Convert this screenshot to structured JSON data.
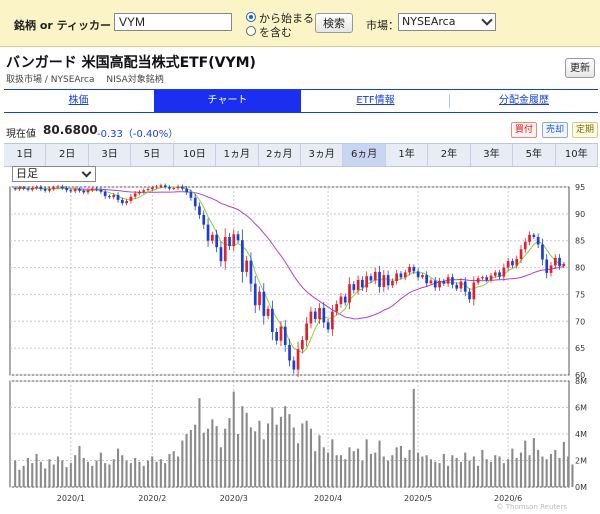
{
  "search": {
    "label": "銘柄 or ティッカー",
    "ticker_value": "VYM",
    "radio_starts": "から始まる",
    "radio_contains": "を含む",
    "search_button": "検索",
    "market_label": "市場：",
    "market_value": "NYSEArca"
  },
  "header": {
    "title": "バンガード 米国高配当株式ETF(VYM)",
    "subtitle": "取扱市場 / NYSEArca　 NISA対象銘柄",
    "refresh_button": "更新"
  },
  "tabs": [
    {
      "label": "株価",
      "active": false
    },
    {
      "label": "チャート",
      "active": true
    },
    {
      "label": "ETF情報",
      "active": false
    },
    {
      "label": "分配金履歴",
      "active": false
    }
  ],
  "price": {
    "label": "現在値",
    "value": "80.6800",
    "change": "-0.33（-0.40%）",
    "buy_label": "買付",
    "sell_label": "売却",
    "fixed_label": "定期"
  },
  "periods": [
    "1日",
    "2日",
    "3日",
    "5日",
    "10日",
    "1ヵ月",
    "2ヵ月",
    "3ヵ月",
    "6ヵ月",
    "1年",
    "2年",
    "3年",
    "5年",
    "10年"
  ],
  "active_period": "6ヵ月",
  "interval": "日足",
  "colors": {
    "up": "#e0202a",
    "down": "#1a3fd8",
    "ma_short": "#8ccf3a",
    "ma_long": "#b23fd3",
    "volume": "#8a8a8a",
    "accent": "#1a2ff0"
  },
  "chart_data": {
    "type": "candlestick",
    "price_axis": {
      "ticks": [
        "95",
        "90",
        "85",
        "80",
        "75",
        "70",
        "65",
        "60"
      ],
      "ylim": [
        60,
        95
      ]
    },
    "volume_axis": {
      "ticks": [
        "8M",
        "6M",
        "4M",
        "2M",
        "0M"
      ],
      "ylim": [
        0,
        8
      ]
    },
    "x_tick_labels": [
      "2020/1",
      "2020/2",
      "2020/3",
      "2020/4",
      "2020/5",
      "2020/6"
    ],
    "x_tick_index": [
      13,
      32,
      51,
      73,
      94,
      115
    ],
    "closes": [
      94.6,
      94.9,
      94.7,
      94.5,
      94.8,
      95.0,
      94.6,
      94.3,
      94.6,
      94.9,
      95.1,
      94.8,
      94.4,
      94.2,
      94.6,
      94.3,
      94.0,
      94.4,
      94.7,
      94.5,
      94.1,
      93.3,
      93.1,
      93.5,
      92.6,
      92.0,
      92.4,
      93.2,
      93.8,
      94.1,
      94.4,
      94.6,
      94.9,
      95.1,
      95.3,
      95.0,
      94.7,
      94.8,
      95.1,
      94.7,
      94.0,
      93.0,
      91.4,
      89.8,
      88.0,
      85.0,
      86.1,
      83.8,
      81.2,
      85.7,
      84.0,
      86.2,
      85.1,
      79.2,
      81.3,
      77.0,
      73.0,
      75.5,
      71.0,
      72.3,
      68.0,
      66.4,
      69.0,
      65.6,
      62.7,
      61.0,
      64.8,
      66.5,
      69.6,
      71.8,
      70.4,
      72.5,
      69.8,
      68.5,
      71.8,
      73.2,
      74.6,
      73.5,
      76.9,
      75.8,
      77.7,
      76.3,
      78.4,
      77.6,
      79.2,
      76.4,
      78.6,
      76.7,
      77.5,
      78.9,
      78.2,
      79.1,
      80.1,
      79.3,
      78.2,
      78.6,
      77.1,
      77.6,
      76.3,
      77.5,
      77.0,
      78.2,
      76.8,
      76.1,
      77.4,
      75.5,
      74.1,
      77.2,
      78.0,
      78.2,
      77.7,
      78.5,
      79.1,
      78.3,
      80.0,
      81.2,
      80.4,
      81.6,
      83.4,
      84.8,
      86.1,
      85.7,
      84.3,
      81.5,
      79.0,
      80.4,
      81.8,
      80.3,
      80.7
    ],
    "volumes": [
      2.0,
      1.3,
      1.6,
      2.2,
      1.8,
      2.5,
      1.9,
      1.4,
      2.1,
      1.7,
      2.3,
      2.0,
      1.5,
      1.8,
      2.4,
      3.1,
      2.2,
      1.9,
      1.6,
      2.0,
      2.6,
      1.8,
      1.7,
      2.1,
      2.9,
      2.4,
      2.0,
      1.8,
      2.2,
      1.9,
      1.6,
      2.0,
      2.3,
      1.9,
      2.1,
      1.8,
      2.5,
      2.7,
      2.3,
      3.5,
      4.0,
      4.3,
      4.7,
      6.7,
      4.1,
      4.4,
      5.1,
      4.6,
      3.0,
      4.4,
      5.2,
      7.2,
      4.0,
      6.1,
      5.6,
      4.5,
      4.2,
      5.0,
      3.6,
      4.8,
      6.0,
      4.7,
      5.3,
      6.1,
      5.5,
      4.5,
      3.3,
      4.8,
      5.0,
      4.4,
      2.7,
      3.9,
      3.0,
      2.6,
      3.6,
      2.4,
      2.4,
      2.1,
      3.0,
      2.7,
      2.9,
      2.0,
      3.6,
      2.5,
      2.6,
      3.5,
      2.3,
      2.0,
      2.4,
      3.0,
      3.1,
      2.2,
      2.8,
      7.4,
      2.6,
      2.3,
      2.4,
      2.1,
      1.9,
      1.8,
      2.5,
      1.6,
      2.4,
      2.2,
      1.9,
      2.6,
      2.0,
      2.3,
      1.6,
      2.8,
      2.1,
      1.9,
      2.4,
      2.3,
      1.8,
      2.1,
      2.9,
      2.2,
      2.6,
      3.5,
      2.4,
      3.7,
      2.8,
      2.3,
      2.1,
      2.5,
      2.8,
      2.2,
      3.4,
      2.3,
      1.7
    ],
    "watermark": "© Thomson Reuters"
  }
}
